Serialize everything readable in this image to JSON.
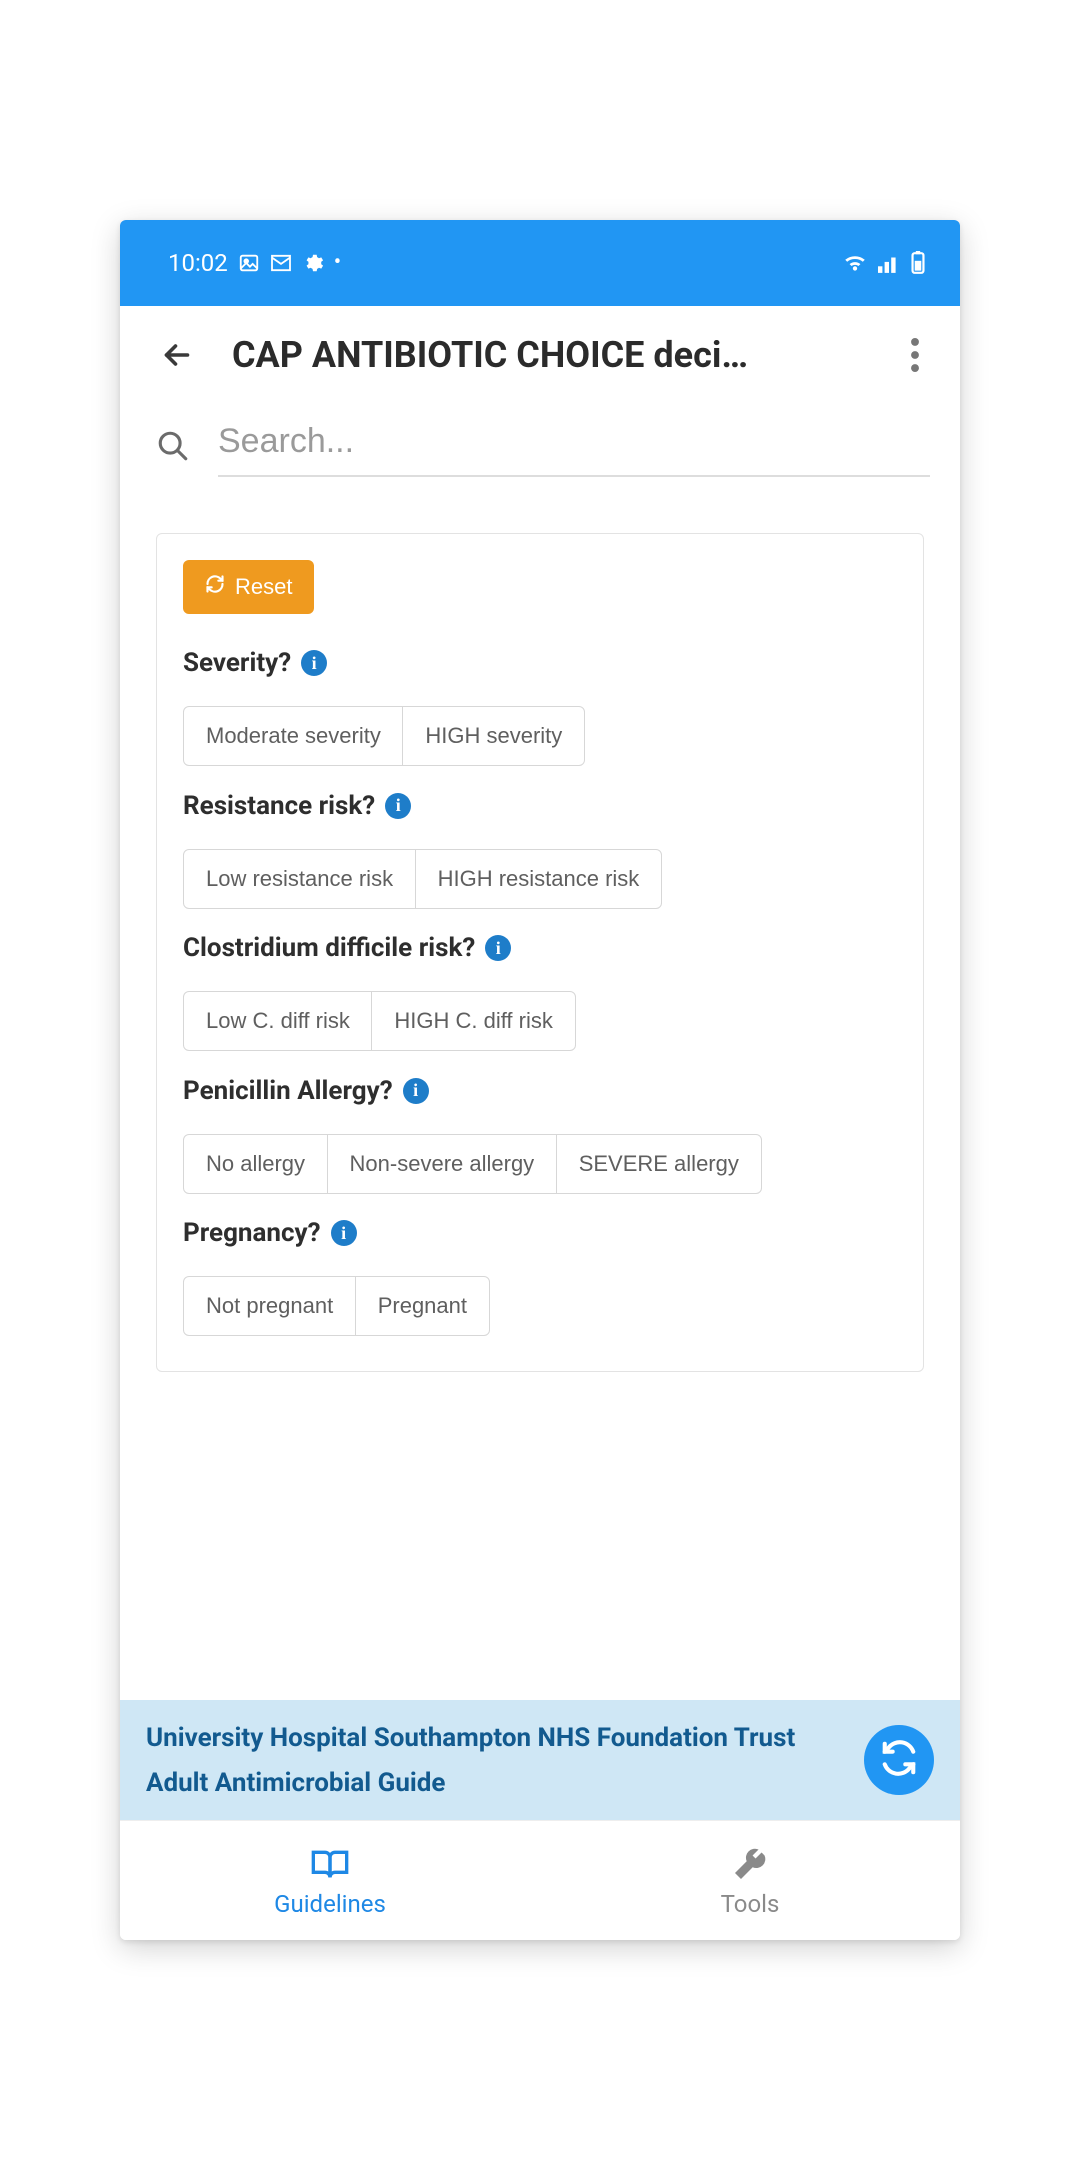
{
  "statusbar": {
    "time": "10:02",
    "left_icons": [
      "image-icon",
      "mail-icon",
      "gear-icon",
      "dot-icon"
    ],
    "right_icons": [
      "wifi-icon",
      "signal-icon",
      "battery-icon"
    ]
  },
  "appbar": {
    "title": "CAP ANTIBIOTIC CHOICE deci…"
  },
  "search": {
    "placeholder": "Search..."
  },
  "reset": {
    "label": "Reset"
  },
  "questions": [
    {
      "label": "Severity?",
      "options": [
        "Moderate severity",
        "HIGH severity"
      ]
    },
    {
      "label": "Resistance risk?",
      "options": [
        "Low resistance risk",
        "HIGH resistance risk"
      ]
    },
    {
      "label": "Clostridium difficile risk?",
      "options": [
        "Low C. diff risk",
        "HIGH C. diff risk"
      ]
    },
    {
      "label": "Penicillin Allergy?",
      "options": [
        "No allergy",
        "Non-severe allergy",
        "SEVERE allergy"
      ]
    },
    {
      "label": "Pregnancy?",
      "options": [
        "Not pregnant",
        "Pregnant"
      ]
    }
  ],
  "banner": {
    "line1": "University Hospital Southampton NHS Foundation Trust",
    "line2": "Adult Antimicrobial Guide"
  },
  "bottomnav": {
    "items": [
      {
        "label": "Guidelines",
        "active": true
      },
      {
        "label": "Tools",
        "active": false
      }
    ]
  },
  "colors": {
    "primary": "#2196f3",
    "accent": "#ef9a1f",
    "info": "#1e7dc9",
    "banner_bg": "#cfe7f5",
    "banner_text": "#125a8f"
  }
}
